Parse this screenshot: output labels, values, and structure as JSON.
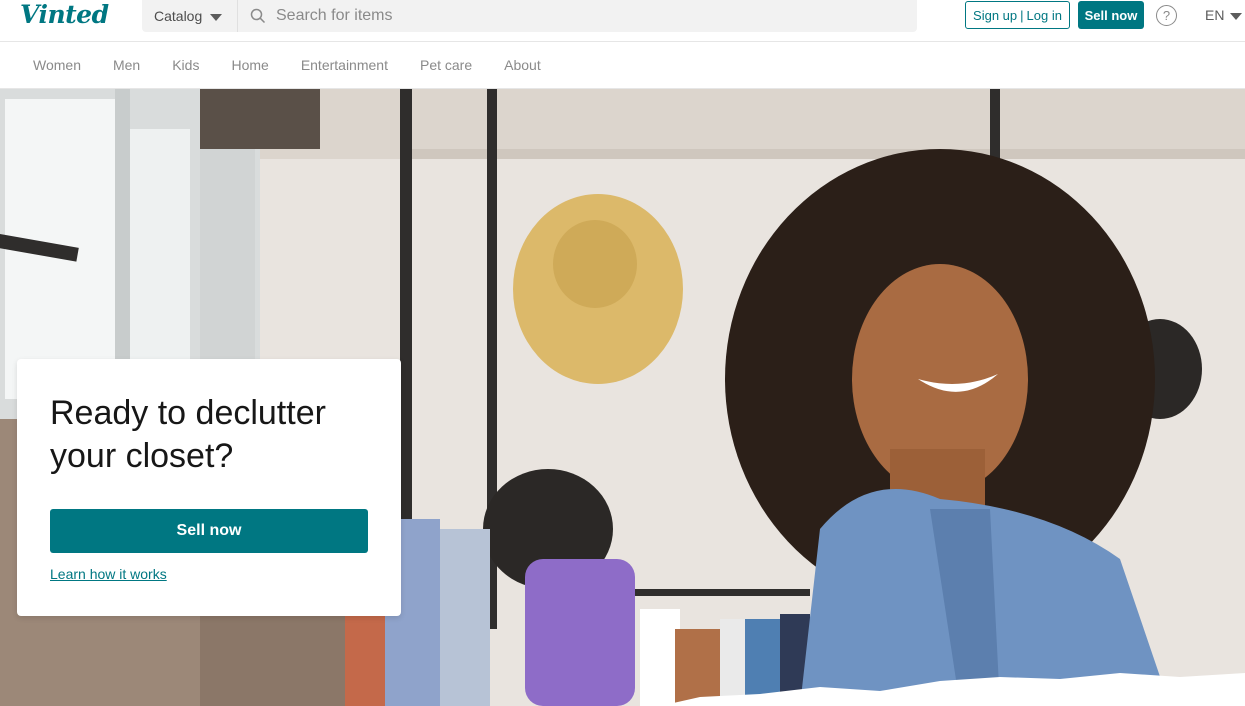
{
  "header": {
    "logo": "Vinted",
    "catalog_label": "Catalog",
    "search_placeholder": "Search for items",
    "signup_label": "Sign up",
    "login_label": "Log in",
    "separator": "|",
    "sell_label": "Sell now",
    "help_symbol": "?",
    "language": "EN"
  },
  "nav": {
    "items": [
      "Women",
      "Men",
      "Kids",
      "Home",
      "Entertainment",
      "Pet care",
      "About"
    ]
  },
  "hero": {
    "title": "Ready to declutter your closet?",
    "sell_button": "Sell now",
    "learn_link": "Learn how it works"
  },
  "colors": {
    "brand": "#007782",
    "text": "#171717",
    "muted": "#8a8a8a"
  },
  "icons": [
    "search-icon",
    "chevron-down-icon",
    "help-icon"
  ]
}
